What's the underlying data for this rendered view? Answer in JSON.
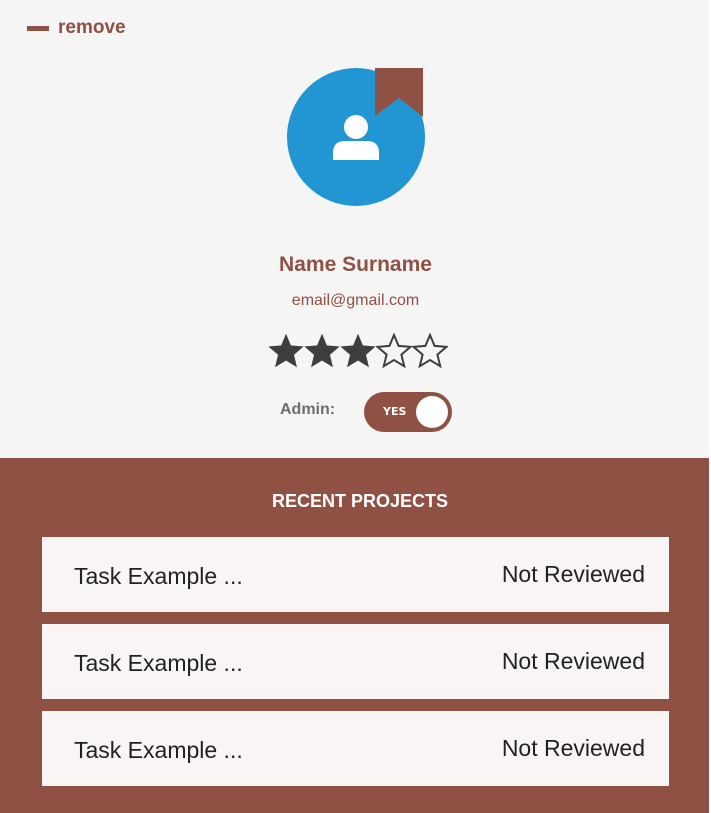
{
  "remove": {
    "label": "remove",
    "icon": "minus-icon"
  },
  "avatar": {
    "icon": "user-icon",
    "badge_icon": "bookmark-icon",
    "color": "#2295d3",
    "badge_color": "#8f5144"
  },
  "profile": {
    "name": "Name Surname",
    "email": "email@gmail.com"
  },
  "rating": {
    "value": 3,
    "max": 5
  },
  "admin": {
    "label": "Admin:",
    "toggle_text": "YES",
    "enabled": true
  },
  "projects": {
    "title": "RECENT PROJECTS",
    "items": [
      {
        "task": "Task Example ...",
        "status": "Not Reviewed"
      },
      {
        "task": "Task Example ...",
        "status": "Not Reviewed"
      },
      {
        "task": "Task Example ...",
        "status": "Not Reviewed"
      }
    ]
  },
  "colors": {
    "accent": "#8f5144",
    "text": "#222222",
    "background": "#f5f5f5"
  }
}
